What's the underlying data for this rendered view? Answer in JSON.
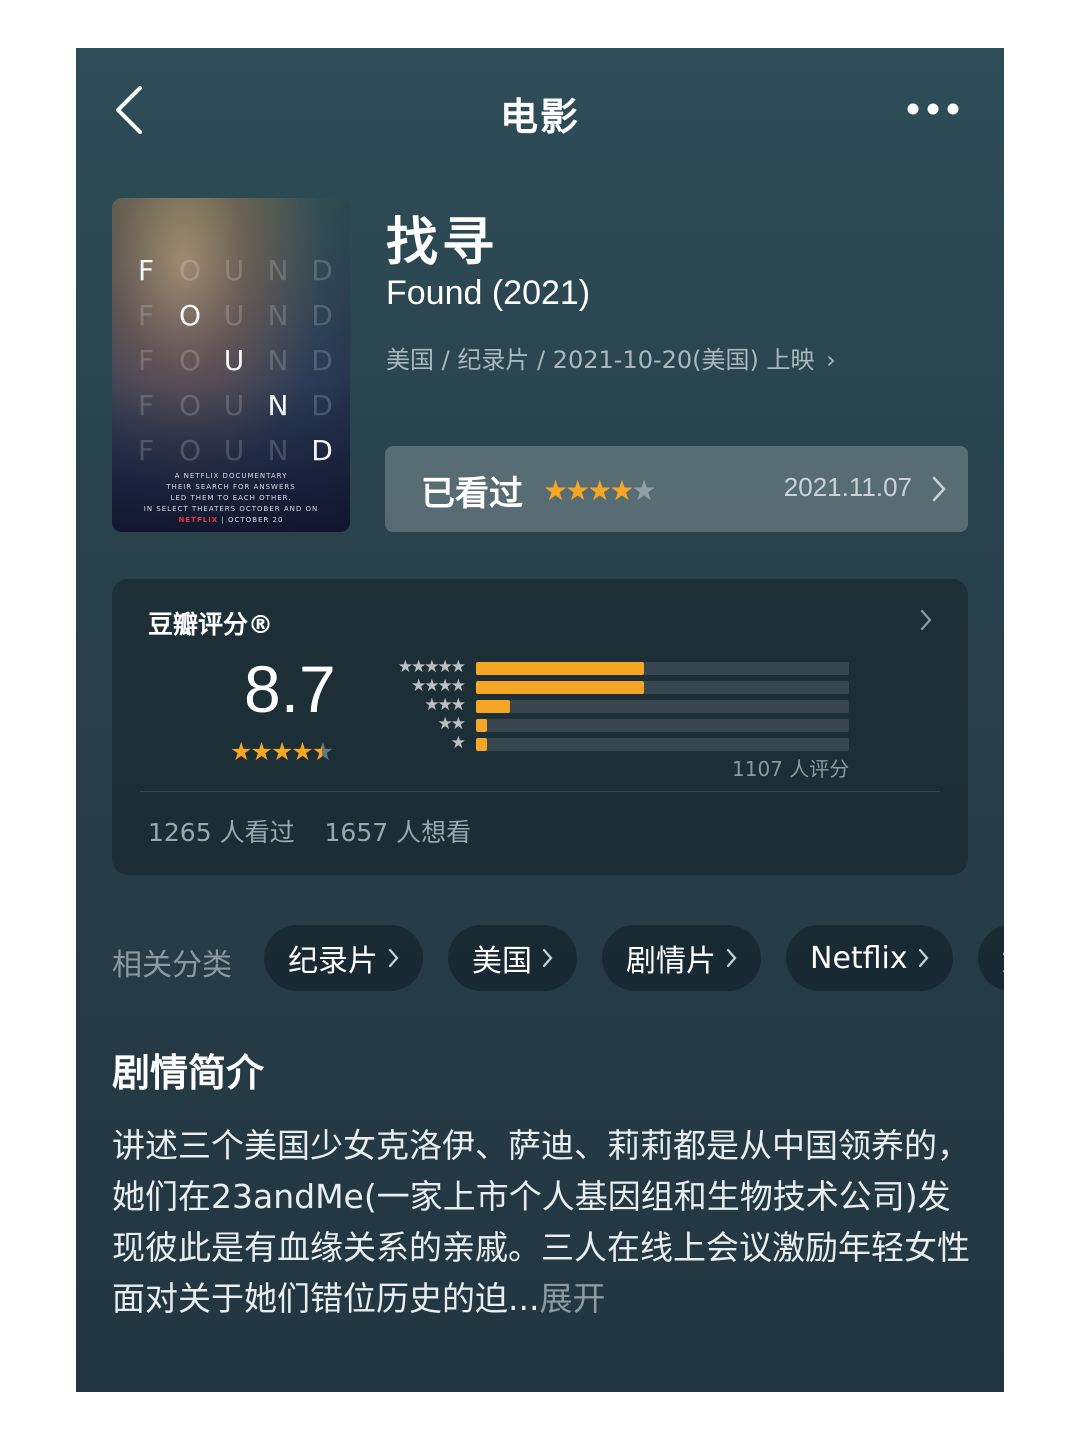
{
  "nav": {
    "title": "电影"
  },
  "poster": {
    "letters": [
      [
        "F",
        "O",
        "U",
        "N",
        "D"
      ],
      [
        "F",
        "O",
        "U",
        "N",
        "D"
      ],
      [
        "F",
        "O",
        "U",
        "N",
        "D"
      ],
      [
        "F",
        "O",
        "U",
        "N",
        "D"
      ],
      [
        "F",
        "O",
        "U",
        "N",
        "D"
      ]
    ],
    "lit": [
      0,
      1,
      2,
      3,
      4
    ],
    "doc_label": "A NETFLIX DOCUMENTARY",
    "tagline_1": "THEIR SEARCH FOR ANSWERS",
    "tagline_2": "LED THEM TO EACH OTHER.",
    "release_1": "IN SELECT THEATERS OCTOBER AND ON",
    "brand": "NETFLIX",
    "release_2": "OCTOBER 20"
  },
  "movie": {
    "title_cn": "找寻",
    "title_en": "Found (2021)",
    "meta": "美国 / 纪录片 / 2021-10-20(美国) 上映"
  },
  "watched": {
    "label": "已看过",
    "user_rating": 4,
    "date": "2021.11.07"
  },
  "rating": {
    "source": "豆瓣评分®",
    "score": "8.7",
    "score_stars": 4.5,
    "distribution": [
      {
        "stars": 5,
        "share": 0.45
      },
      {
        "stars": 4,
        "share": 0.45
      },
      {
        "stars": 3,
        "share": 0.09
      },
      {
        "stars": 2,
        "share": 0.03
      },
      {
        "stars": 1,
        "share": 0.03
      }
    ],
    "count_label": "1107 人评分",
    "watched_count": "1265 人看过",
    "want_count": "1657 人想看"
  },
  "categories": {
    "label": "相关分类",
    "items": [
      "纪录片",
      "美国",
      "剧情片",
      "Netflix",
      "女"
    ]
  },
  "synopsis": {
    "title": "剧情简介",
    "text": "讲述三个美国少女克洛伊、萨迪、莉莉都是从中国领养的，她们在23andMe(一家上市个人基因组和生物技术公司)发现彼此是有血缘关系的亲戚。三人在线上会议激励年轻女性面对关于她们错位历史的迫...",
    "more": "展开"
  },
  "colors": {
    "accent": "#f5a623",
    "background_top": "#2e4d58",
    "background_bottom": "#223641"
  }
}
